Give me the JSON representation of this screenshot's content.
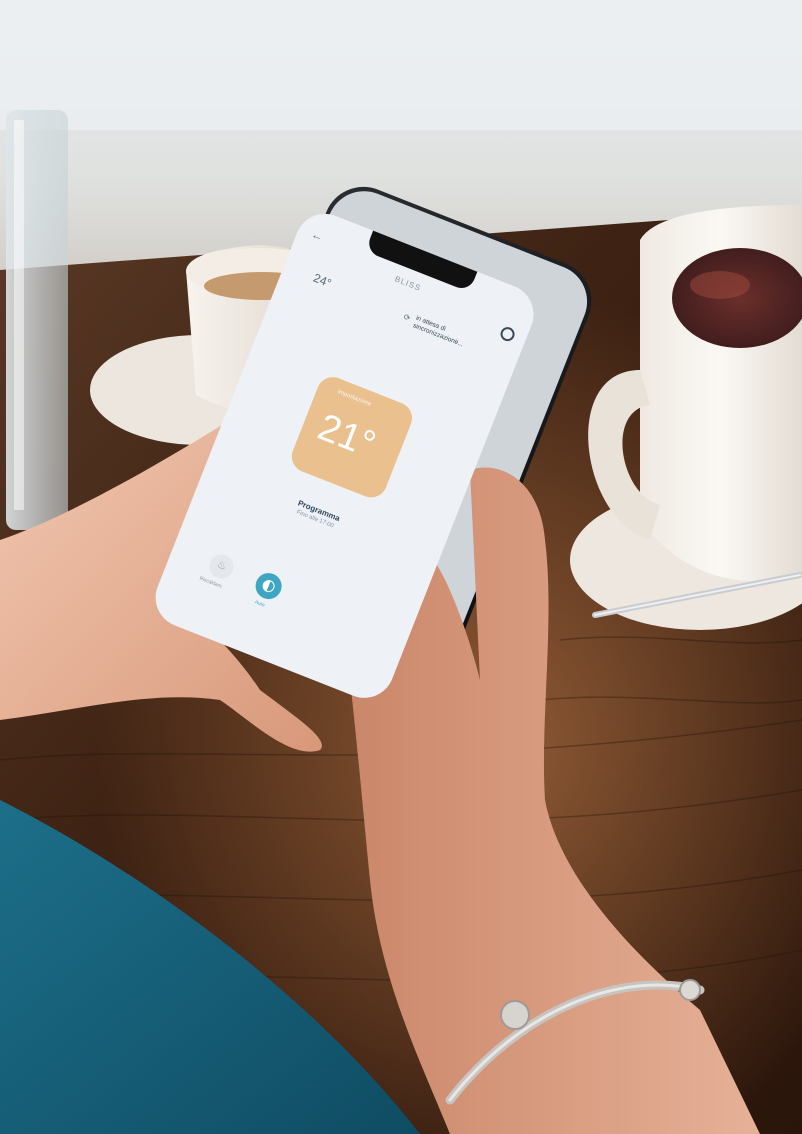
{
  "photo": {
    "description": "Hands holding a smartphone running a thermostat app over a wooden café table with coffee cups"
  },
  "app": {
    "header": {
      "title": "BLISS"
    },
    "indoor_temp": "24°",
    "sync_status": "in attesa di sincronizzazione...",
    "setpoint": {
      "label": "Impostazione",
      "value": "21°"
    },
    "program": {
      "title": "Programma",
      "subtitle": "Fino alle 17:00"
    },
    "bottom_modes": [
      {
        "icon": "flame-icon",
        "label": "Riscaldam."
      },
      {
        "icon": "half-moon-icon",
        "label": "Auto",
        "active": true
      }
    ]
  },
  "colors": {
    "setpoint_tile": "#E9C08E",
    "accent": "#3FA6C2",
    "program_text": "#2E4A5C",
    "screen_bg": "#EEF1F5",
    "table_wood": "#3A1E10"
  }
}
